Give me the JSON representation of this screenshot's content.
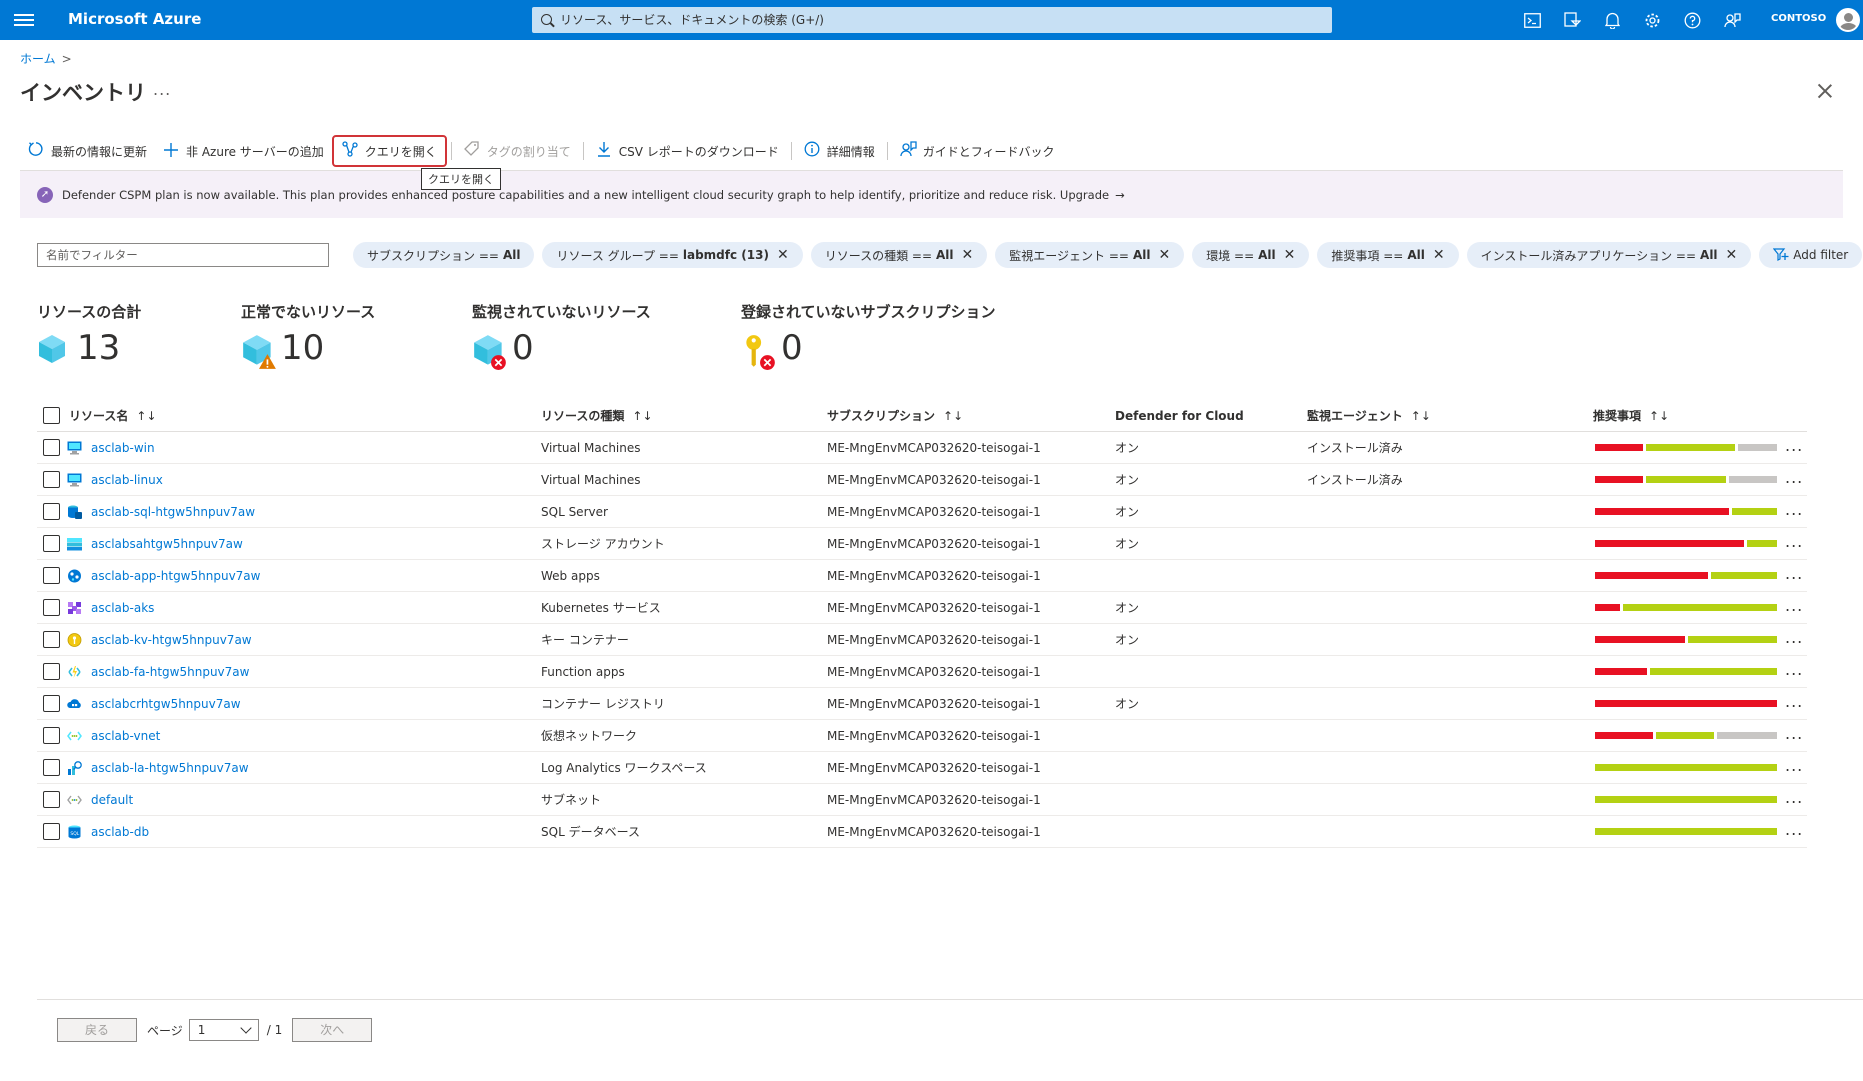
{
  "topbar": {
    "brand": "Microsoft Azure",
    "search_placeholder": "リソース、サービス、ドキュメントの検索 (G+/)",
    "user": "CONTOSO",
    "accent": "#0078d4"
  },
  "breadcrumb": {
    "home": "ホーム",
    "sep": ">"
  },
  "page": {
    "title": "インベントリ",
    "more": "..."
  },
  "toolbar": {
    "refresh": "最新の情報に更新",
    "add_server": "非 Azure サーバーの追加",
    "open_query": "クエリを開く",
    "assign_tags": "タグの割り当て",
    "download_csv": "CSV レポートのダウンロード",
    "learn_more": "詳細情報",
    "guide_feedback": "ガイドとフィードバック",
    "tooltip": "クエリを開く"
  },
  "banner": {
    "text": "Defender CSPM plan is now available. This plan provides enhanced posture capabilities and a new intelligent cloud security graph to help identify, prioritize and reduce risk. Upgrade",
    "arrow": "→"
  },
  "filters": {
    "name_placeholder": "名前でフィルター",
    "pills": [
      {
        "name": "サブスクリプション ==",
        "value": "All",
        "removable": false
      },
      {
        "name": "リソース グループ ==",
        "value": "labmdfc (13)",
        "removable": true
      },
      {
        "name": "リソースの種類 ==",
        "value": "All",
        "removable": true
      },
      {
        "name": "監視エージェント ==",
        "value": "All",
        "removable": true
      },
      {
        "name": "環境 ==",
        "value": "All",
        "removable": true
      },
      {
        "name": "推奨事項 ==",
        "value": "All",
        "removable": true
      },
      {
        "name": "インストール済みアプリケーション ==",
        "value": "All",
        "removable": true
      }
    ],
    "add_filter": "Add filter"
  },
  "stats": {
    "total": {
      "label": "リソースの合計",
      "value": "13"
    },
    "unhealthy": {
      "label": "正常でないリソース",
      "value": "10"
    },
    "unmonitored": {
      "label": "監視されていないリソース",
      "value": "0"
    },
    "unregistered": {
      "label": "登録されていないサブスクリプション",
      "value": "0"
    }
  },
  "table": {
    "headers": {
      "name": "リソース名",
      "type": "リソースの種類",
      "subscription": "サブスクリプション",
      "defender": "Defender for Cloud",
      "agent": "監視エージェント",
      "recommendations": "推奨事項",
      "sort": "↑↓"
    },
    "rows": [
      {
        "name": "asclab-win",
        "icon": "vm-icon",
        "type": "Virtual Machines",
        "sub": "ME-MngEnvMCAP032620-teisogai-1",
        "defender": "オン",
        "agent": "インストール済み",
        "rec": [
          0.27,
          0.51,
          0.22
        ]
      },
      {
        "name": "asclab-linux",
        "icon": "vm-icon",
        "type": "Virtual Machines",
        "sub": "ME-MngEnvMCAP032620-teisogai-1",
        "defender": "オン",
        "agent": "インストール済み",
        "rec": [
          0.27,
          0.46,
          0.27
        ]
      },
      {
        "name": "asclab-sql-htgw5hnpuv7aw",
        "icon": "sql-server-icon",
        "type": "SQL Server",
        "sub": "ME-MngEnvMCAP032620-teisogai-1",
        "defender": "オン",
        "agent": "",
        "rec": [
          0.75,
          0.25,
          0
        ]
      },
      {
        "name": "asclabsahtgw5hnpuv7aw",
        "icon": "storage-account-icon",
        "type": "ストレージ アカウント",
        "sub": "ME-MngEnvMCAP032620-teisogai-1",
        "defender": "オン",
        "agent": "",
        "rec": [
          0.83,
          0.17,
          0
        ]
      },
      {
        "name": "asclab-app-htgw5hnpuv7aw",
        "icon": "web-app-icon",
        "type": "Web apps",
        "sub": "ME-MngEnvMCAP032620-teisogai-1",
        "defender": "",
        "agent": "",
        "rec": [
          0.63,
          0.37,
          0
        ]
      },
      {
        "name": "asclab-aks",
        "icon": "kubernetes-icon",
        "type": "Kubernetes サービス",
        "sub": "ME-MngEnvMCAP032620-teisogai-1",
        "defender": "オン",
        "agent": "",
        "rec": [
          0.14,
          0.86,
          0
        ]
      },
      {
        "name": "asclab-kv-htgw5hnpuv7aw",
        "icon": "key-vault-icon",
        "type": "キー コンテナー",
        "sub": "ME-MngEnvMCAP032620-teisogai-1",
        "defender": "オン",
        "agent": "",
        "rec": [
          0.5,
          0.5,
          0
        ]
      },
      {
        "name": "asclab-fa-htgw5hnpuv7aw",
        "icon": "function-app-icon",
        "type": "Function apps",
        "sub": "ME-MngEnvMCAP032620-teisogai-1",
        "defender": "",
        "agent": "",
        "rec": [
          0.29,
          0.71,
          0
        ]
      },
      {
        "name": "asclabcrhtgw5hnpuv7aw",
        "icon": "container-registry-icon",
        "type": "コンテナー レジストリ",
        "sub": "ME-MngEnvMCAP032620-teisogai-1",
        "defender": "オン",
        "agent": "",
        "rec": [
          1,
          0,
          0
        ]
      },
      {
        "name": "asclab-vnet",
        "icon": "virtual-network-icon",
        "type": "仮想ネットワーク",
        "sub": "ME-MngEnvMCAP032620-teisogai-1",
        "defender": "",
        "agent": "",
        "rec": [
          0.33,
          0.33,
          0.34
        ]
      },
      {
        "name": "asclab-la-htgw5hnpuv7aw",
        "icon": "log-analytics-icon",
        "type": "Log Analytics ワークスペース",
        "sub": "ME-MngEnvMCAP032620-teisogai-1",
        "defender": "",
        "agent": "",
        "rec": [
          0,
          1,
          0
        ]
      },
      {
        "name": "default",
        "icon": "subnet-icon",
        "type": "サブネット",
        "sub": "ME-MngEnvMCAP032620-teisogai-1",
        "defender": "",
        "agent": "",
        "rec": [
          0,
          1,
          0
        ]
      },
      {
        "name": "asclab-db",
        "icon": "sql-database-icon",
        "type": "SQL データベース",
        "sub": "ME-MngEnvMCAP032620-teisogai-1",
        "defender": "",
        "agent": "",
        "rec": [
          0,
          1,
          0
        ]
      }
    ],
    "row_more": "..."
  },
  "pager": {
    "prev": "戻る",
    "page_label": "ページ",
    "page": "1",
    "of": "/ 1",
    "next": "次へ"
  },
  "colors": {
    "red": "#e81123",
    "green": "#b4d113",
    "grey": "#c8c6c4",
    "link": "#0078d4"
  }
}
